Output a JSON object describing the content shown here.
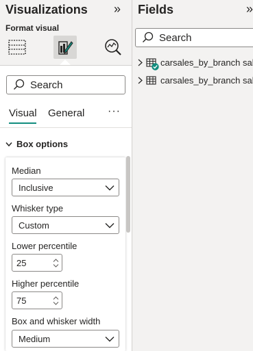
{
  "visualizations": {
    "title": "Visualizations",
    "collapse_glyph": "»",
    "format_visual_label": "Format visual",
    "search_placeholder": "Search",
    "tabs": [
      {
        "label": "Visual",
        "active": true
      },
      {
        "label": "General",
        "active": false
      }
    ],
    "more_glyph": "···",
    "section": {
      "title": "Box options",
      "expanded": true
    },
    "fields": {
      "median": {
        "label": "Median",
        "value": "Inclusive"
      },
      "whisker_type": {
        "label": "Whisker type",
        "value": "Custom"
      },
      "lower_percentile": {
        "label": "Lower percentile",
        "value": "25"
      },
      "higher_percentile": {
        "label": "Higher percentile",
        "value": "75"
      },
      "box_whisker_width": {
        "label": "Box and whisker width",
        "value": "Medium"
      }
    }
  },
  "fields_pane": {
    "title": "Fields",
    "collapse_glyph": "»",
    "search_placeholder": "Search",
    "tables": [
      {
        "name": "carsales_by_branch sale",
        "has_check": true
      },
      {
        "name": "carsales_by_branch sale",
        "has_check": false
      }
    ]
  },
  "colors": {
    "accent": "#118c7e",
    "pane_bg": "#f3f2f1",
    "border": "#8a8886"
  }
}
